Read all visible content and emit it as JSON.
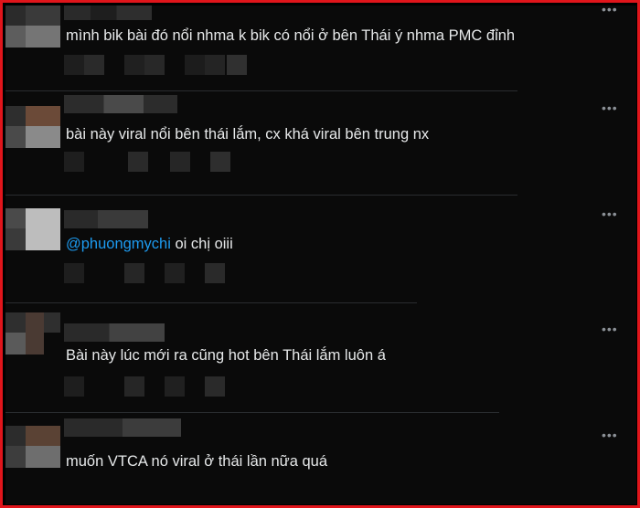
{
  "comments": [
    {
      "text": "mình bik bài đó nổi nhma k bik có nổi ở bên Thái ý nhma PMC đỉnh"
    },
    {
      "text": "bài này viral nổi bên thái lắm, cx khá viral bên trung nx"
    },
    {
      "mention": "@phuongmychi",
      "text": " oi chị oiii"
    },
    {
      "text": "Bài này lúc mới ra cũng hot bên Thái lắm luôn á"
    },
    {
      "text": "muốn VTCA nó viral ở thái lần nữa quá"
    }
  ],
  "more_icon": "more-horizontal-icon",
  "more_glyph": "•••",
  "colors": {
    "frame": "#e0151b",
    "background": "#0a0a0a",
    "text": "#e7e9ea",
    "mention": "#1d9bf0",
    "muted": "#8b9096",
    "divider": "#2a2d30"
  }
}
